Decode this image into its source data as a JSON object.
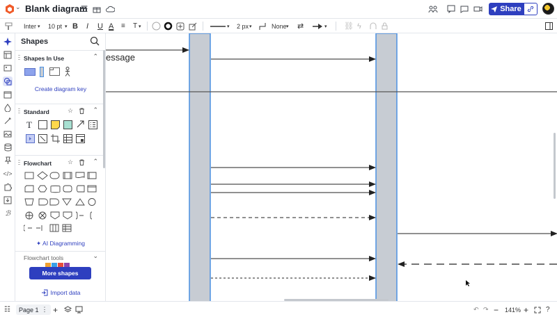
{
  "app": {
    "doc_title": "Blank diagram",
    "share_label": "Share"
  },
  "toolbar": {
    "font": "Inter",
    "font_size": "10 pt",
    "bold": "B",
    "italic": "I",
    "underline": "U",
    "text_color": "A",
    "text_options": "T",
    "line_width": "2 px",
    "line_start": "None"
  },
  "panel": {
    "title": "Shapes",
    "in_use": {
      "title": "Shapes In Use",
      "create_key": "Create diagram key"
    },
    "standard": {
      "title": "Standard",
      "text_tool": "T"
    },
    "flowchart": {
      "title": "Flowchart",
      "ai": "AI Diagramming"
    },
    "flowchart_tools": {
      "title": "Flowchart tools"
    },
    "more_shapes": "More shapes",
    "import_data": "Import data"
  },
  "canvas": {
    "partial_label": "essage"
  },
  "bottom": {
    "page": "Page 1",
    "zoom": "141%"
  },
  "colors": {
    "accent": "#2e3fbf",
    "lifeline_fill": "#c7ccd3",
    "lifeline_border": "#4a90e2"
  }
}
